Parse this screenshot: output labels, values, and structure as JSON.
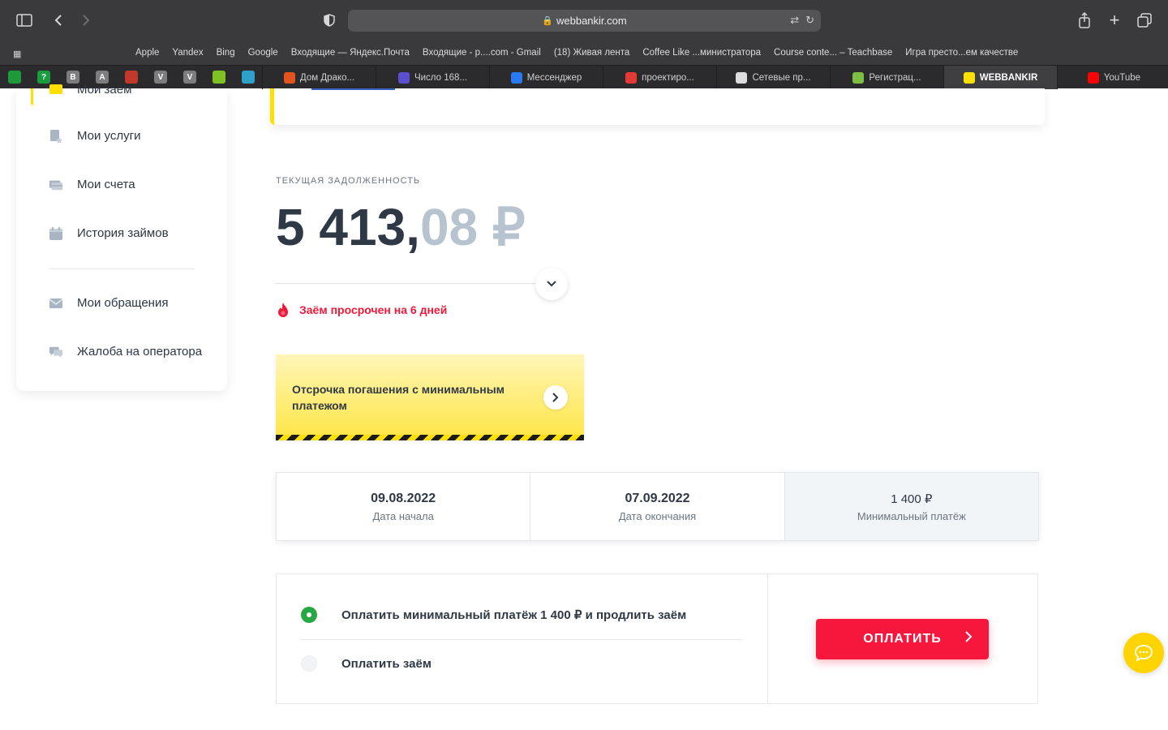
{
  "browser": {
    "url": "webbankir.com",
    "favorites": [
      "Apple",
      "Yandex",
      "Bing",
      "Google",
      "Входящие — Яндекс.Почта",
      "Входящие - р....com - Gmail",
      "(18) Живая лента",
      "Coffee Like ...министратора",
      "Course conte... – Teachbase",
      "Игра престо...ем качестве"
    ],
    "pinned_tabs": [
      {
        "label": "",
        "color": "#1f9a3a"
      },
      {
        "label": "?",
        "color": "#1a9c3e"
      },
      {
        "label": "B",
        "color": "#7d7d80"
      },
      {
        "label": "A",
        "color": "#7d7d80"
      },
      {
        "label": "",
        "color": "#c0392b"
      },
      {
        "label": "V",
        "color": "#7d7d80"
      },
      {
        "label": "V",
        "color": "#7d7d80"
      },
      {
        "label": "",
        "color": "#7fc224"
      },
      {
        "label": "",
        "color": "#2ea0c9"
      }
    ],
    "tabs": [
      {
        "label": "Дом Драко...",
        "color": "#e2541e",
        "active": false
      },
      {
        "label": "Число 168...",
        "color": "#5a4fcf",
        "active": false
      },
      {
        "label": "Мессенджер",
        "color": "#2a7af0",
        "active": false
      },
      {
        "label": "проектиро...",
        "color": "#e53935",
        "active": false
      },
      {
        "label": "Сетевые пр...",
        "color": "#dddddd",
        "active": false
      },
      {
        "label": "Регистрац...",
        "color": "#7bc043",
        "active": false
      },
      {
        "label": "WEBBANKIR",
        "color": "#ffe000",
        "active": true
      },
      {
        "label": "YouTube",
        "color": "#ff0000",
        "active": false
      }
    ]
  },
  "sidebar": {
    "items": [
      {
        "label": "Мои заём"
      },
      {
        "label": "Мои услуги"
      },
      {
        "label": "Мои счета"
      },
      {
        "label": "История займов"
      },
      {
        "label": "Мои обращения"
      },
      {
        "label": "Жалоба на оператора"
      }
    ]
  },
  "debt": {
    "label": "ТЕКУЩАЯ ЗАДОЛЖЕННОСТЬ",
    "amount_int": "5 413,",
    "amount_frac": "08 ₽",
    "overdue_text": "Заём просрочен на 6 дней"
  },
  "promo": {
    "text": "Отсрочка погашения с минимальным платежом"
  },
  "info": [
    {
      "value": "09.08.2022",
      "label": "Дата начала"
    },
    {
      "value": "07.09.2022",
      "label": "Дата окончания"
    },
    {
      "value": "1 400 ₽",
      "label": "Минимальный платёж"
    }
  ],
  "payment": {
    "options": [
      {
        "label": "Оплатить минимальный платёж 1 400 ₽ и продлить заём",
        "selected": true
      },
      {
        "label": "Оплатить заём",
        "selected": false
      }
    ],
    "button_label": "ОПЛАТИТЬ"
  },
  "colors": {
    "accent_yellow": "#ffe000",
    "danger_red": "#f7163c",
    "success_green": "#28a745"
  }
}
